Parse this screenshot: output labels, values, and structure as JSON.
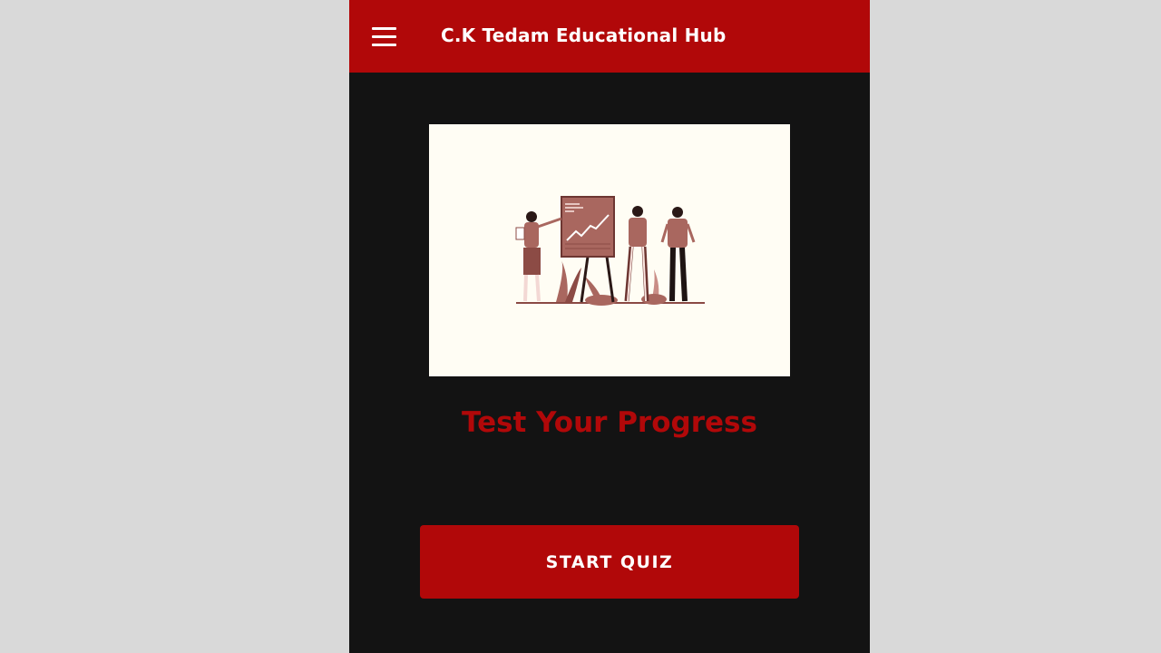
{
  "app": {
    "title": "C.K Tedam Educational Hub",
    "menu_icon": "hamburger-menu-icon"
  },
  "hero": {
    "illustration": "presentation-chart-illustration"
  },
  "main": {
    "heading": "Test Your Progress",
    "start_button_label": "START QUIZ"
  },
  "colors": {
    "accent": "#b10809",
    "background": "#131313",
    "outer_background": "#d9d9d9",
    "illustration_bg": "#fffdf4"
  }
}
